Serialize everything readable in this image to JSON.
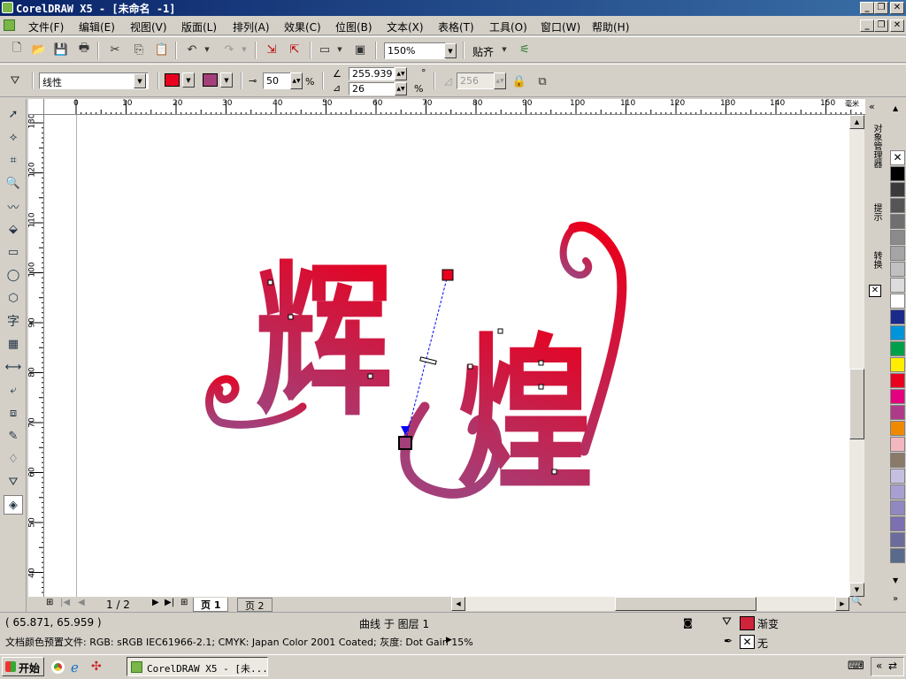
{
  "window": {
    "title": "CorelDRAW X5 - [未命名 -1]"
  },
  "menu": [
    "文件(F)",
    "编辑(E)",
    "视图(V)",
    "版面(L)",
    "排列(A)",
    "效果(C)",
    "位图(B)",
    "文本(X)",
    "表格(T)",
    "工具(O)",
    "窗口(W)",
    "帮助(H)"
  ],
  "toolbar": {
    "zoom": "150%",
    "snap": "贴齐"
  },
  "propbar": {
    "fill_type": "线性",
    "color_from": "#e8001e",
    "color_to": "#a3407a",
    "midpoint": "50",
    "angle": "255.939",
    "steps": "26",
    "edge": "256",
    "percent_symbol": "%",
    "degree_symbol": "°"
  },
  "ruler": {
    "h_labels": [
      "0",
      "10",
      "20",
      "30",
      "40",
      "50",
      "60",
      "70",
      "80",
      "90",
      "100",
      "110",
      "120",
      "130",
      "140",
      "150"
    ],
    "h_unit": "毫米",
    "v_labels": [
      "130",
      "120",
      "110",
      "100",
      "90",
      "80",
      "70",
      "60",
      "50",
      "40"
    ]
  },
  "artwork": {
    "text_1": "辉",
    "text_2": "煌",
    "gradient_start": "#e8001e",
    "gradient_end": "#a3407a"
  },
  "pages": {
    "current": "1 / 2",
    "tabs": [
      "页 1",
      "页 2"
    ]
  },
  "docker": {
    "tabs": [
      "对象管理器",
      "提示",
      "转换"
    ]
  },
  "palette": [
    "#000000",
    "#3a3a3a",
    "#555555",
    "#6f6f6f",
    "#8a8a8a",
    "#a5a5a5",
    "#c0c0c0",
    "#dcdcdc",
    "#ffffff",
    "#1a2a8a",
    "#0094d8",
    "#00a04a",
    "#ffee00",
    "#e8001e",
    "#e4007f",
    "#b03a8a",
    "#ef8a00",
    "#f2b8c0",
    "#8a7a6a",
    "#c6c0e0",
    "#a8a0d0",
    "#9088c0",
    "#7c70b0",
    "#6c6c9c",
    "#5a6a8a"
  ],
  "status": {
    "coords": "( 65.871, 65.959 )",
    "object": "曲线 于 图层 1",
    "profile": "文档颜色预置文件: RGB: sRGB IEC61966-2.1; CMYK: Japan Color 2001 Coated; 灰度: Dot Gain 15%",
    "fill_label": "渐变",
    "outline_label": "无",
    "fill_color": "#d0243c"
  },
  "taskbar": {
    "start": "开始",
    "task": "CorelDRAW X5 - [未..."
  }
}
